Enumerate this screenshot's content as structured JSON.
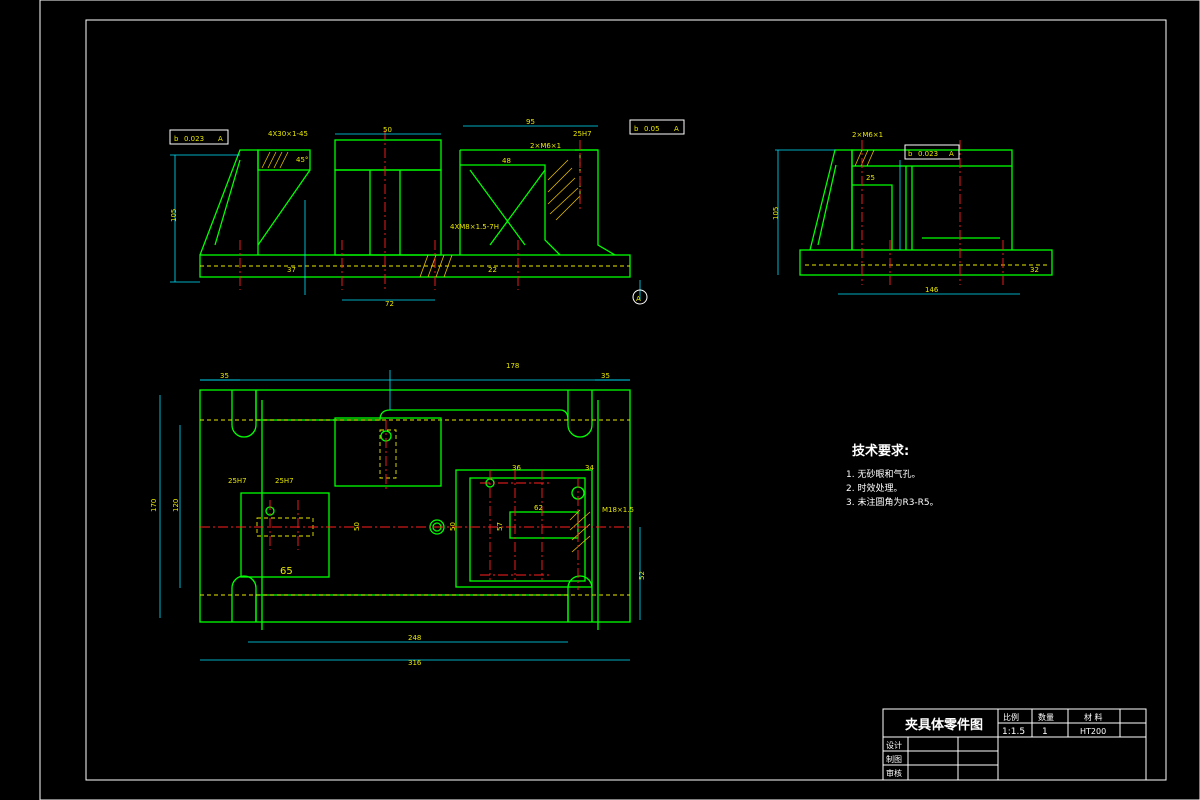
{
  "tech": {
    "title": "技术要求:",
    "items": [
      "1. 无砂眼和气孔。",
      "2. 时效处理。",
      "3. 未注圆角为R3-R5。"
    ]
  },
  "title_block": {
    "part_name": "夹具体零件图",
    "h_scale": "比例",
    "h_qty": "数量",
    "h_material": "材 料",
    "scale": "1:1.5",
    "qty": "1",
    "material": "HT200",
    "designer": "设计",
    "drafter": "制图",
    "reviewer": "审核"
  },
  "front": {
    "tol1_sym": "b",
    "tol1_val": "0.023",
    "tol1_ref": "A",
    "tol2_sym": "b",
    "tol2_val": "0.05",
    "tol2_ref": "A",
    "d_chamfer": "4X30×1-45",
    "d_45": "45°",
    "d_50": "50",
    "d_95": "95",
    "d_thread": "2×M6×1",
    "d_25h7": "25H7",
    "d_4x": "4XM8×1.5-7H",
    "d_105": "105",
    "d_72": "72",
    "d_37": "37",
    "d_22": "22",
    "d_48": "48",
    "datum": "A"
  },
  "side": {
    "tol_sym": "b",
    "tol_val": "0.023",
    "tol_ref": "A",
    "d_thread": "2×M6×1",
    "d_105": "105",
    "d_146": "146",
    "d_25": "25",
    "d_32": "32"
  },
  "plan": {
    "d_178": "178",
    "d_35a": "35",
    "d_35b": "35",
    "d_170": "170",
    "d_120": "120",
    "d_248": "248",
    "d_316": "316",
    "d_65": "65",
    "d_50a": "50",
    "d_50b": "50",
    "d_25h7a": "25H7",
    "d_25h7b": "25H7",
    "d_m18": "M18×1.5",
    "d_36": "36",
    "d_34": "34",
    "d_62": "62",
    "d_57": "57",
    "d_52": "52"
  }
}
